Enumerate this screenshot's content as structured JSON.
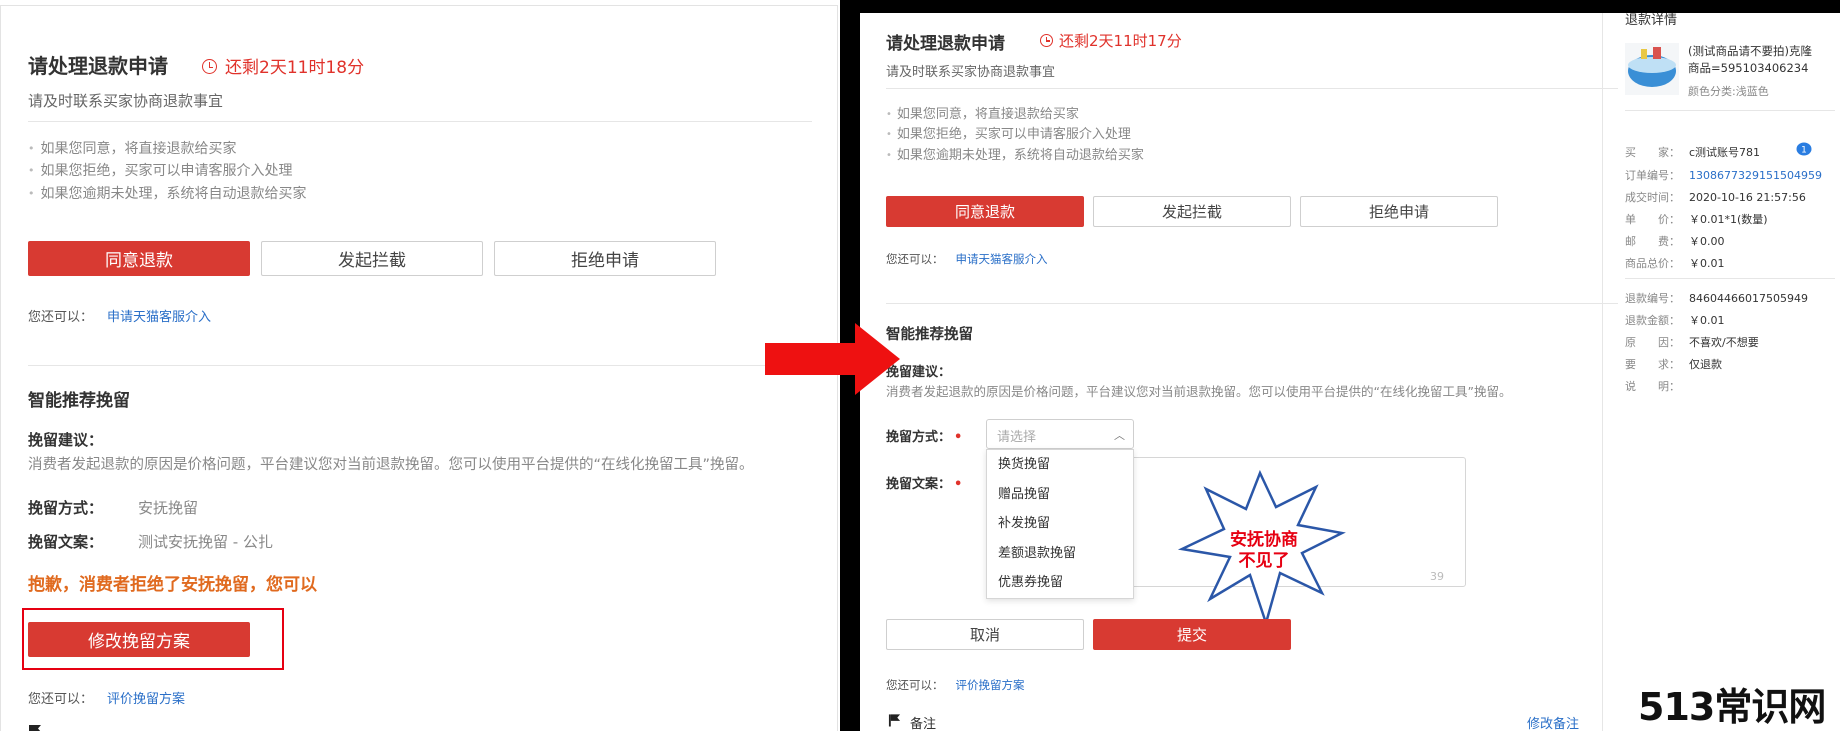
{
  "left": {
    "title": "请处理退款申请",
    "timer": "还剩2天11时18分",
    "subtitle": "请及时联系买家协商退款事宜",
    "bullets": [
      "如果您同意，将直接退款给买家",
      "如果您拒绝，买家可以申请客服介入处理",
      "如果您逾期未处理，系统将自动退款给买家"
    ],
    "agree_label": "同意退款",
    "intercept_label": "发起拦截",
    "reject_label": "拒绝申请",
    "also_label": "您还可以：",
    "also_link": "申请天猫客服介入",
    "section_title": "智能推荐挽留",
    "suggestion_label": "挽留建议：",
    "suggestion_text": "消费者发起退款的原因是价格问题，平台建议您对当前退款挽留。您可以使用平台提供的“在线化挽留工具”挽留。",
    "way_label": "挽留方式：",
    "way_value": "安抚挽留",
    "copy_label": "挽留文案：",
    "copy_value": "测试安抚挽留 - 公扎",
    "sorry_text": "抱歉，消费者拒绝了安抚挽留，您可以",
    "modify_label": "修改挽留方案",
    "also2_label": "您还可以：",
    "also2_link": "评价挽留方案"
  },
  "right": {
    "title": "请处理退款申请",
    "timer": "还剩2天11时17分",
    "subtitle": "请及时联系买家协商退款事宜",
    "bullets": [
      "如果您同意，将直接退款给买家",
      "如果您拒绝，买家可以申请客服介入处理",
      "如果您逾期未处理，系统将自动退款给买家"
    ],
    "agree_label": "同意退款",
    "intercept_label": "发起拦截",
    "reject_label": "拒绝申请",
    "also_label": "您还可以：",
    "also_link": "申请天猫客服介入",
    "section_title": "智能推荐挽留",
    "suggestion_label": "挽留建议：",
    "suggestion_text": "消费者发起退款的原因是价格问题，平台建议您对当前退款挽留。您可以使用平台提供的“在线化挽留工具”挽留。",
    "way_label": "挽留方式：",
    "select_placeholder": "请选择",
    "options": [
      "换货挽留",
      "赠品挽留",
      "补发挽留",
      "差额退款挽留",
      "优惠券挽留"
    ],
    "copy_label": "挽留文案：",
    "counter": "39",
    "cancel_label": "取消",
    "submit_label": "提交",
    "also2_label": "您还可以：",
    "also2_link": "评价挽留方案",
    "remark_label": "备注",
    "modify_note": "修改备注",
    "burst_line1": "安抚协商",
    "burst_line2": "不见了"
  },
  "detail": {
    "header": "退款详情",
    "product_name": "(测试商品请不要拍)克隆商品=595103406234",
    "variant": "颜色分类:浅蓝色",
    "rows1": [
      {
        "k": "买　　家：",
        "v": "c测试账号781"
      },
      {
        "k": "订单编号：",
        "v": "1308677329151504959",
        "link": true
      },
      {
        "k": "成交时间：",
        "v": "2020-10-16 21:57:56"
      },
      {
        "k": "单　　价：",
        "v": "￥0.01*1(数量)"
      },
      {
        "k": "邮　　费：",
        "v": "￥0.00"
      },
      {
        "k": "商品总价：",
        "v": "￥0.01"
      }
    ],
    "rows2": [
      {
        "k": "退款编号：",
        "v": "84604466017505949"
      },
      {
        "k": "退款金额：",
        "v": "￥0.01"
      },
      {
        "k": "原　　因：",
        "v": "不喜欢/不想要"
      },
      {
        "k": "要　　求：",
        "v": "仅退款"
      },
      {
        "k": "说　　明：",
        "v": ""
      }
    ]
  },
  "watermark": "513常识网",
  "colors": {
    "accent_red": "#d83a32",
    "link_blue": "#2a6fc8",
    "warning_orange": "#e06a1f",
    "annotation_red": "#e60012"
  }
}
